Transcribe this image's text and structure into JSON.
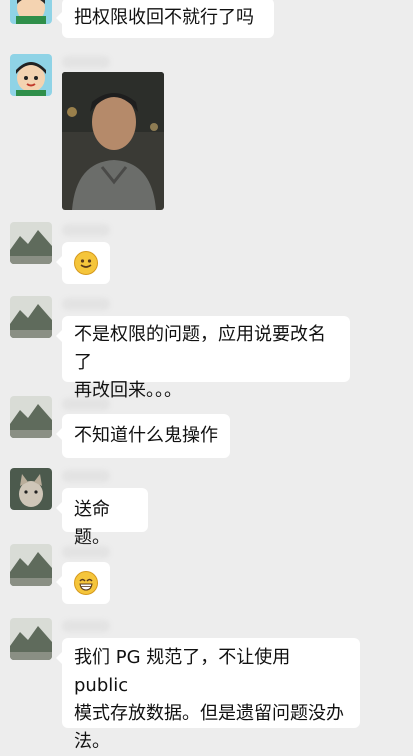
{
  "messages": [
    {
      "text": "把权限收回不就行了吗"
    },
    {
      "type": "photo"
    },
    {
      "type": "emoji",
      "emoji": "smile-emoji"
    },
    {
      "text_line1": "不是权限的问题，应用说要改名了",
      "text_line2": "再改回来。。。"
    },
    {
      "text": "不知道什么鬼操作"
    },
    {
      "text": "送命题。"
    },
    {
      "type": "emoji",
      "emoji": "grin-emoji"
    },
    {
      "text_line1": "我们 PG 规范了，不让使用 public",
      "text_line2": "模式存放数据。但是遗留问题没办",
      "text_line3": "法。"
    }
  ],
  "colors": {
    "background": "#ededed",
    "bubble": "#ffffff"
  }
}
